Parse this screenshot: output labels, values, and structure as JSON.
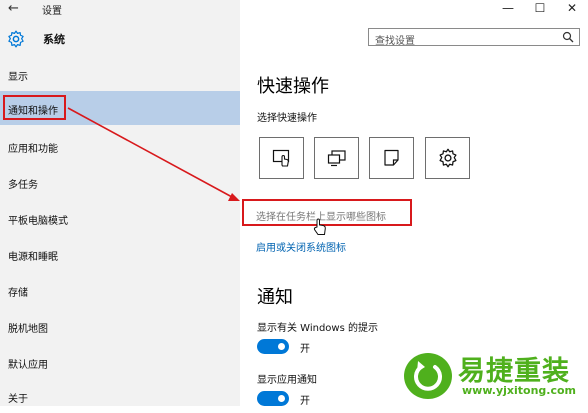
{
  "titlebar": {
    "back_glyph": "←",
    "title": "设置",
    "minimize_glyph": "—",
    "maximize_glyph": "☐",
    "close_glyph": "✕"
  },
  "header": {
    "title": "系统"
  },
  "search": {
    "placeholder": "查找设置"
  },
  "sidebar": {
    "items": [
      {
        "label": "显示"
      },
      {
        "label": "通知和操作",
        "selected": true
      },
      {
        "label": "应用和功能"
      },
      {
        "label": "多任务"
      },
      {
        "label": "平板电脑模式"
      },
      {
        "label": "电源和睡眠"
      },
      {
        "label": "存储"
      },
      {
        "label": "脱机地图"
      },
      {
        "label": "默认应用"
      },
      {
        "label": "关于"
      }
    ]
  },
  "main": {
    "quick_actions_heading": "快速操作",
    "quick_actions_sub": "选择快速操作",
    "quick_action_icons": [
      "tablet-mode-icon",
      "project-icon",
      "note-icon",
      "settings-icon"
    ],
    "taskbar_icons_link": "选择在任务栏上显示哪些图标",
    "system_icons_link": "启用或关闭系统图标",
    "notifications_heading": "通知",
    "tips_label": "显示有关 Windows 的提示",
    "tips_toggle": "开",
    "app_notifications_label": "显示应用通知",
    "app_notifications_toggle": "开"
  },
  "watermark": {
    "brand": "易捷重装",
    "url": "www.yjxitong.com"
  },
  "colors": {
    "accent": "#0078d7",
    "selected_item_bg": "#b8cee8",
    "annotation_red": "#d8191c",
    "link_blue": "#0063b1",
    "watermark_green": "#4fb01d"
  }
}
